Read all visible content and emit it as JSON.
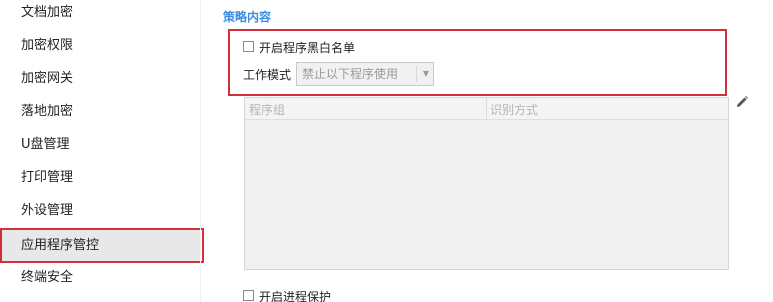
{
  "sidebar": {
    "items": [
      {
        "label": "文档加密"
      },
      {
        "label": "加密权限"
      },
      {
        "label": "加密网关"
      },
      {
        "label": "落地加密"
      },
      {
        "label": "U盘管理"
      },
      {
        "label": "打印管理"
      },
      {
        "label": "外设管理"
      },
      {
        "label": "应用程序管控"
      },
      {
        "label": "终端安全"
      }
    ],
    "active_item": "应用程序管控"
  },
  "main": {
    "section_title": "策略内容",
    "whitelist_checkbox": {
      "label": "开启程序黑白名单",
      "checked": false
    },
    "work_mode": {
      "label": "工作模式",
      "selected": "禁止以下程序使用",
      "disabled": true
    },
    "table": {
      "columns": [
        "程序组",
        "识别方式"
      ],
      "rows": []
    },
    "edit_icon": "pencil-icon",
    "process_protection_checkbox": {
      "label": "开启进程保护",
      "checked": false
    }
  },
  "colors": {
    "accent": "#3a8ee6",
    "highlight_border": "#d32f3a",
    "active_item_bg": "#e8e8e8"
  }
}
